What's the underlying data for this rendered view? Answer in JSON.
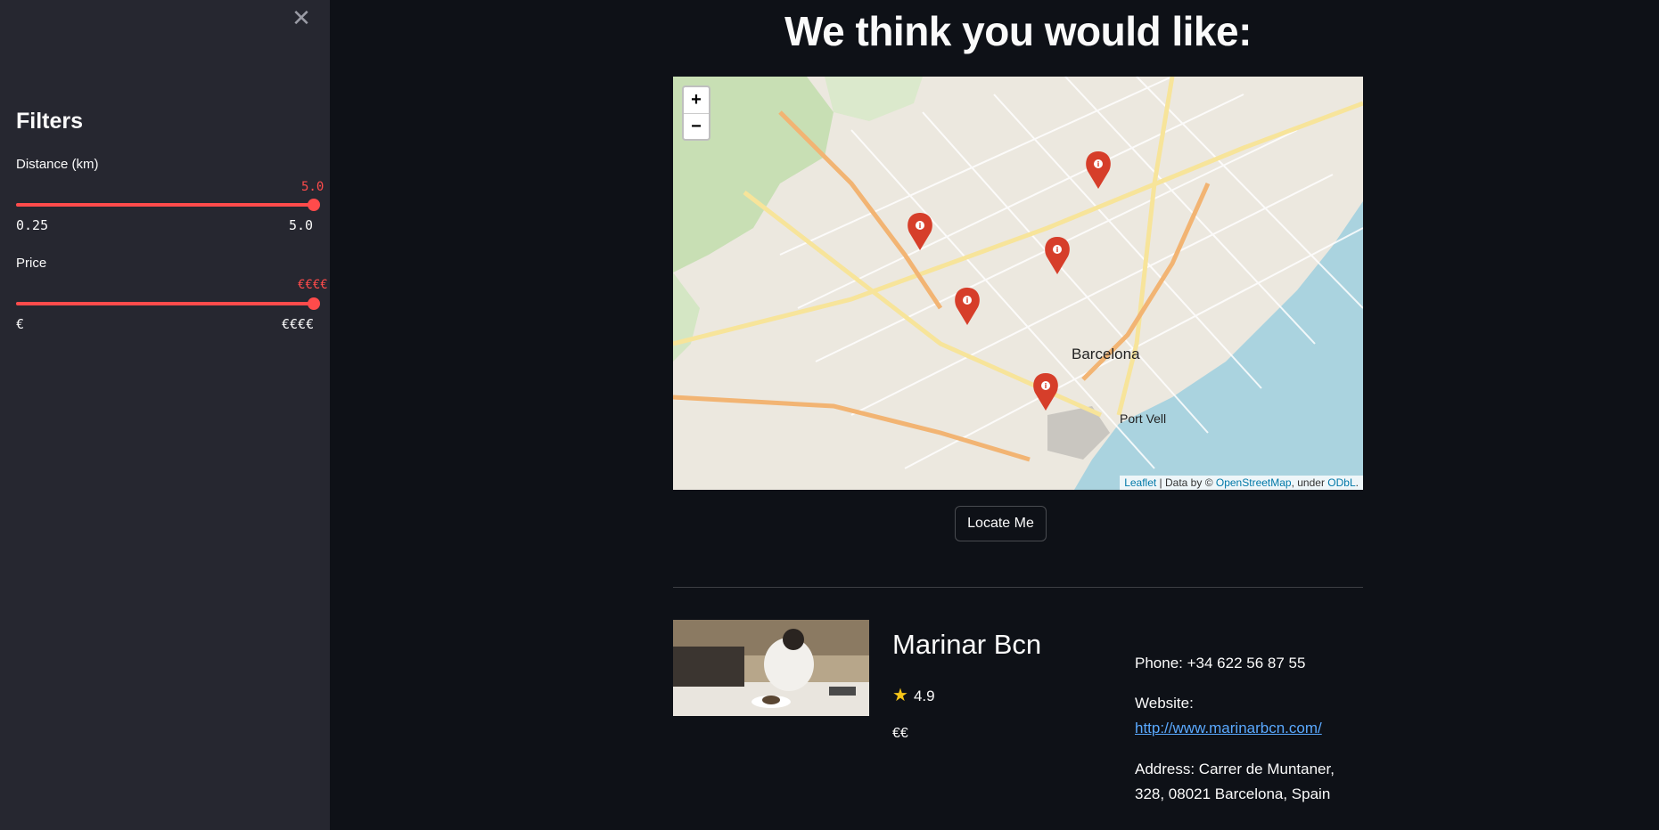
{
  "sidebar": {
    "close_icon": "✕",
    "title": "Filters",
    "distance": {
      "label": "Distance (km)",
      "value": "5.0",
      "min": "0.25",
      "max": "5.0",
      "fraction": 1.0
    },
    "price": {
      "label": "Price",
      "value": "€€€€",
      "min": "€",
      "max": "€€€€",
      "fraction": 1.0
    }
  },
  "main": {
    "title": "We think you would like:",
    "map": {
      "zoom_in": "+",
      "zoom_out": "−",
      "labels": [
        "Barcelona",
        "Port Vell"
      ],
      "attribution": {
        "leaflet": "Leaflet",
        "sep1": " | Data by © ",
        "osm": "OpenStreetMap",
        "sep2": ", under ",
        "odbl": "ODbL",
        "end": "."
      },
      "marker_icon": "map-pin-info-icon"
    },
    "locate_button": "Locate Me",
    "restaurant": {
      "name": "Marinar Bcn",
      "rating": "4.9",
      "price": "€€",
      "phone": "Phone: +34 622 56 87 55",
      "website_label": "Website:",
      "website": "http://www.marinarbcn.com/",
      "address": "Address: Carrer de Muntaner, 328, 08021 Barcelona, Spain"
    }
  },
  "colors": {
    "accent": "#ff4b4b",
    "background": "#0e1117",
    "sidebar": "#262730",
    "link": "#5aa9ff",
    "marker": "#d63e2a",
    "sea": "#aad3df"
  }
}
